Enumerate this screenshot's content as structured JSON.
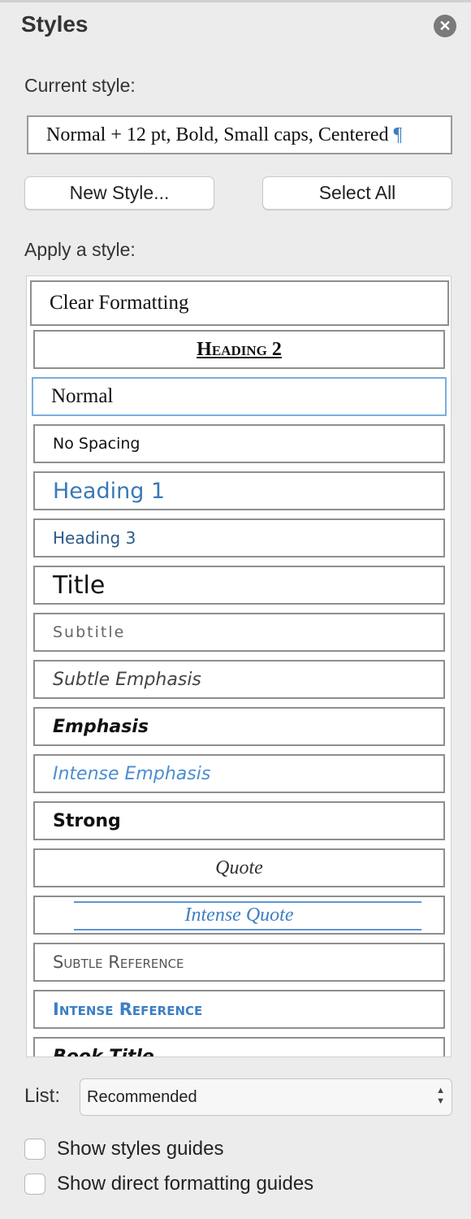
{
  "panel": {
    "title": "Styles",
    "close_icon": "close-icon"
  },
  "current_style": {
    "label": "Current style:",
    "value": "Normal + 12 pt, Bold, Small caps, Centered",
    "pilcrow": "¶"
  },
  "buttons": {
    "new_style": "New Style...",
    "select_all": "Select All"
  },
  "apply": {
    "label": "Apply a style:",
    "items": [
      {
        "label": "Clear Formatting"
      },
      {
        "label": "Heading 2"
      },
      {
        "label": "Normal",
        "selected": true
      },
      {
        "label": "No Spacing"
      },
      {
        "label": "Heading 1"
      },
      {
        "label": "Heading 3"
      },
      {
        "label": "Title"
      },
      {
        "label": "Subtitle"
      },
      {
        "label": "Subtle Emphasis"
      },
      {
        "label": "Emphasis"
      },
      {
        "label": "Intense Emphasis"
      },
      {
        "label": "Strong"
      },
      {
        "label": "Quote"
      },
      {
        "label": "Intense Quote"
      },
      {
        "label": "Subtle Reference"
      },
      {
        "label": "Intense Reference"
      },
      {
        "label": "Book Title"
      }
    ]
  },
  "list": {
    "label": "List:",
    "selected": "Recommended"
  },
  "options": [
    {
      "label": "Show styles guides",
      "checked": false
    },
    {
      "label": "Show direct formatting guides",
      "checked": false
    }
  ],
  "colors": {
    "accent": "#3d7fc4",
    "selection_border": "#78aee0"
  }
}
